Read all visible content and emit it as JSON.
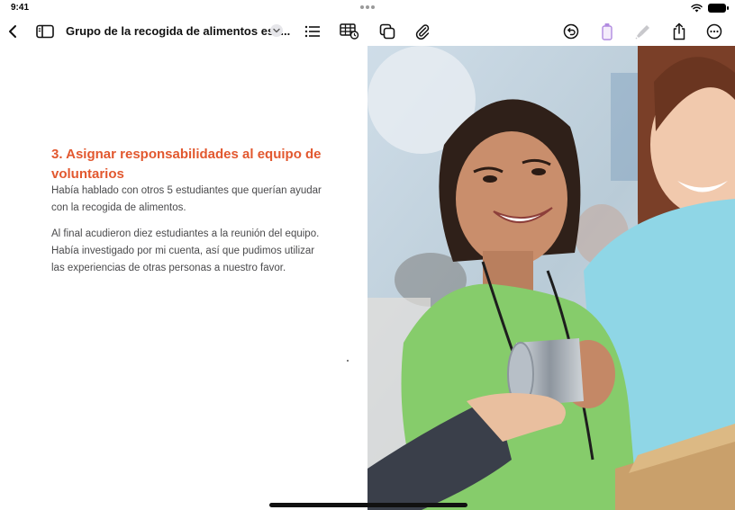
{
  "status_bar": {
    "time": "9:41"
  },
  "toolbar": {
    "document_title": "Grupo de la recogida de alimentos esc...",
    "icons": {
      "back": "chevron-left-icon",
      "sidebar": "sidebar-icon",
      "title_menu": "chevron-down-icon",
      "list": "list-icon",
      "table": "table-icon",
      "shapes": "shapes-icon",
      "attachment": "paperclip-icon",
      "undo": "undo-icon",
      "highlighter": "highlighter-icon",
      "pen": "pen-icon",
      "share": "share-icon",
      "more": "more-icon"
    }
  },
  "content": {
    "heading": "3. Asignar responsabilidades al equipo de voluntarios",
    "paragraph_1": "Había hablado con otros 5 estudiantes que querían ayudar con la recogida de alimentos.",
    "paragraph_2": "Al final acudieron diez estudiantes a la reunión del equipo. Había investigado por mi cuenta, así que pudimos utilizar las experiencias de otras personas a nuestro favor."
  },
  "colors": {
    "heading_accent": "#e2582f",
    "highlighter_accent": "#b18ae0",
    "body_text": "#4a4a4c"
  }
}
